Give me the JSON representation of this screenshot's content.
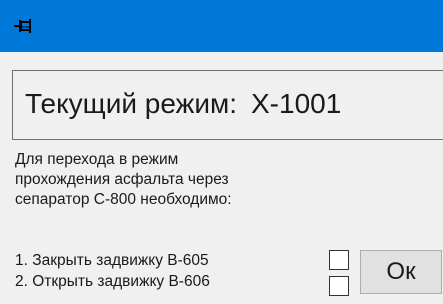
{
  "window": {
    "title_icon": "pin-icon"
  },
  "header": {
    "label": "Текущий режим:",
    "value": "X-1001"
  },
  "instruction": {
    "lines": [
      "Для перехода в режим",
      "прохождения асфальта через",
      "сепаратор С-800 необходимо:"
    ]
  },
  "steps": [
    {
      "label": "1. Закрыть задвижку В-605",
      "checked": false
    },
    {
      "label": "2. Открыть задвижку В-606",
      "checked": false
    }
  ],
  "buttons": {
    "ok_label": "Ок"
  },
  "colors": {
    "titlebar": "#0078d7",
    "background": "#f0f0f0"
  }
}
